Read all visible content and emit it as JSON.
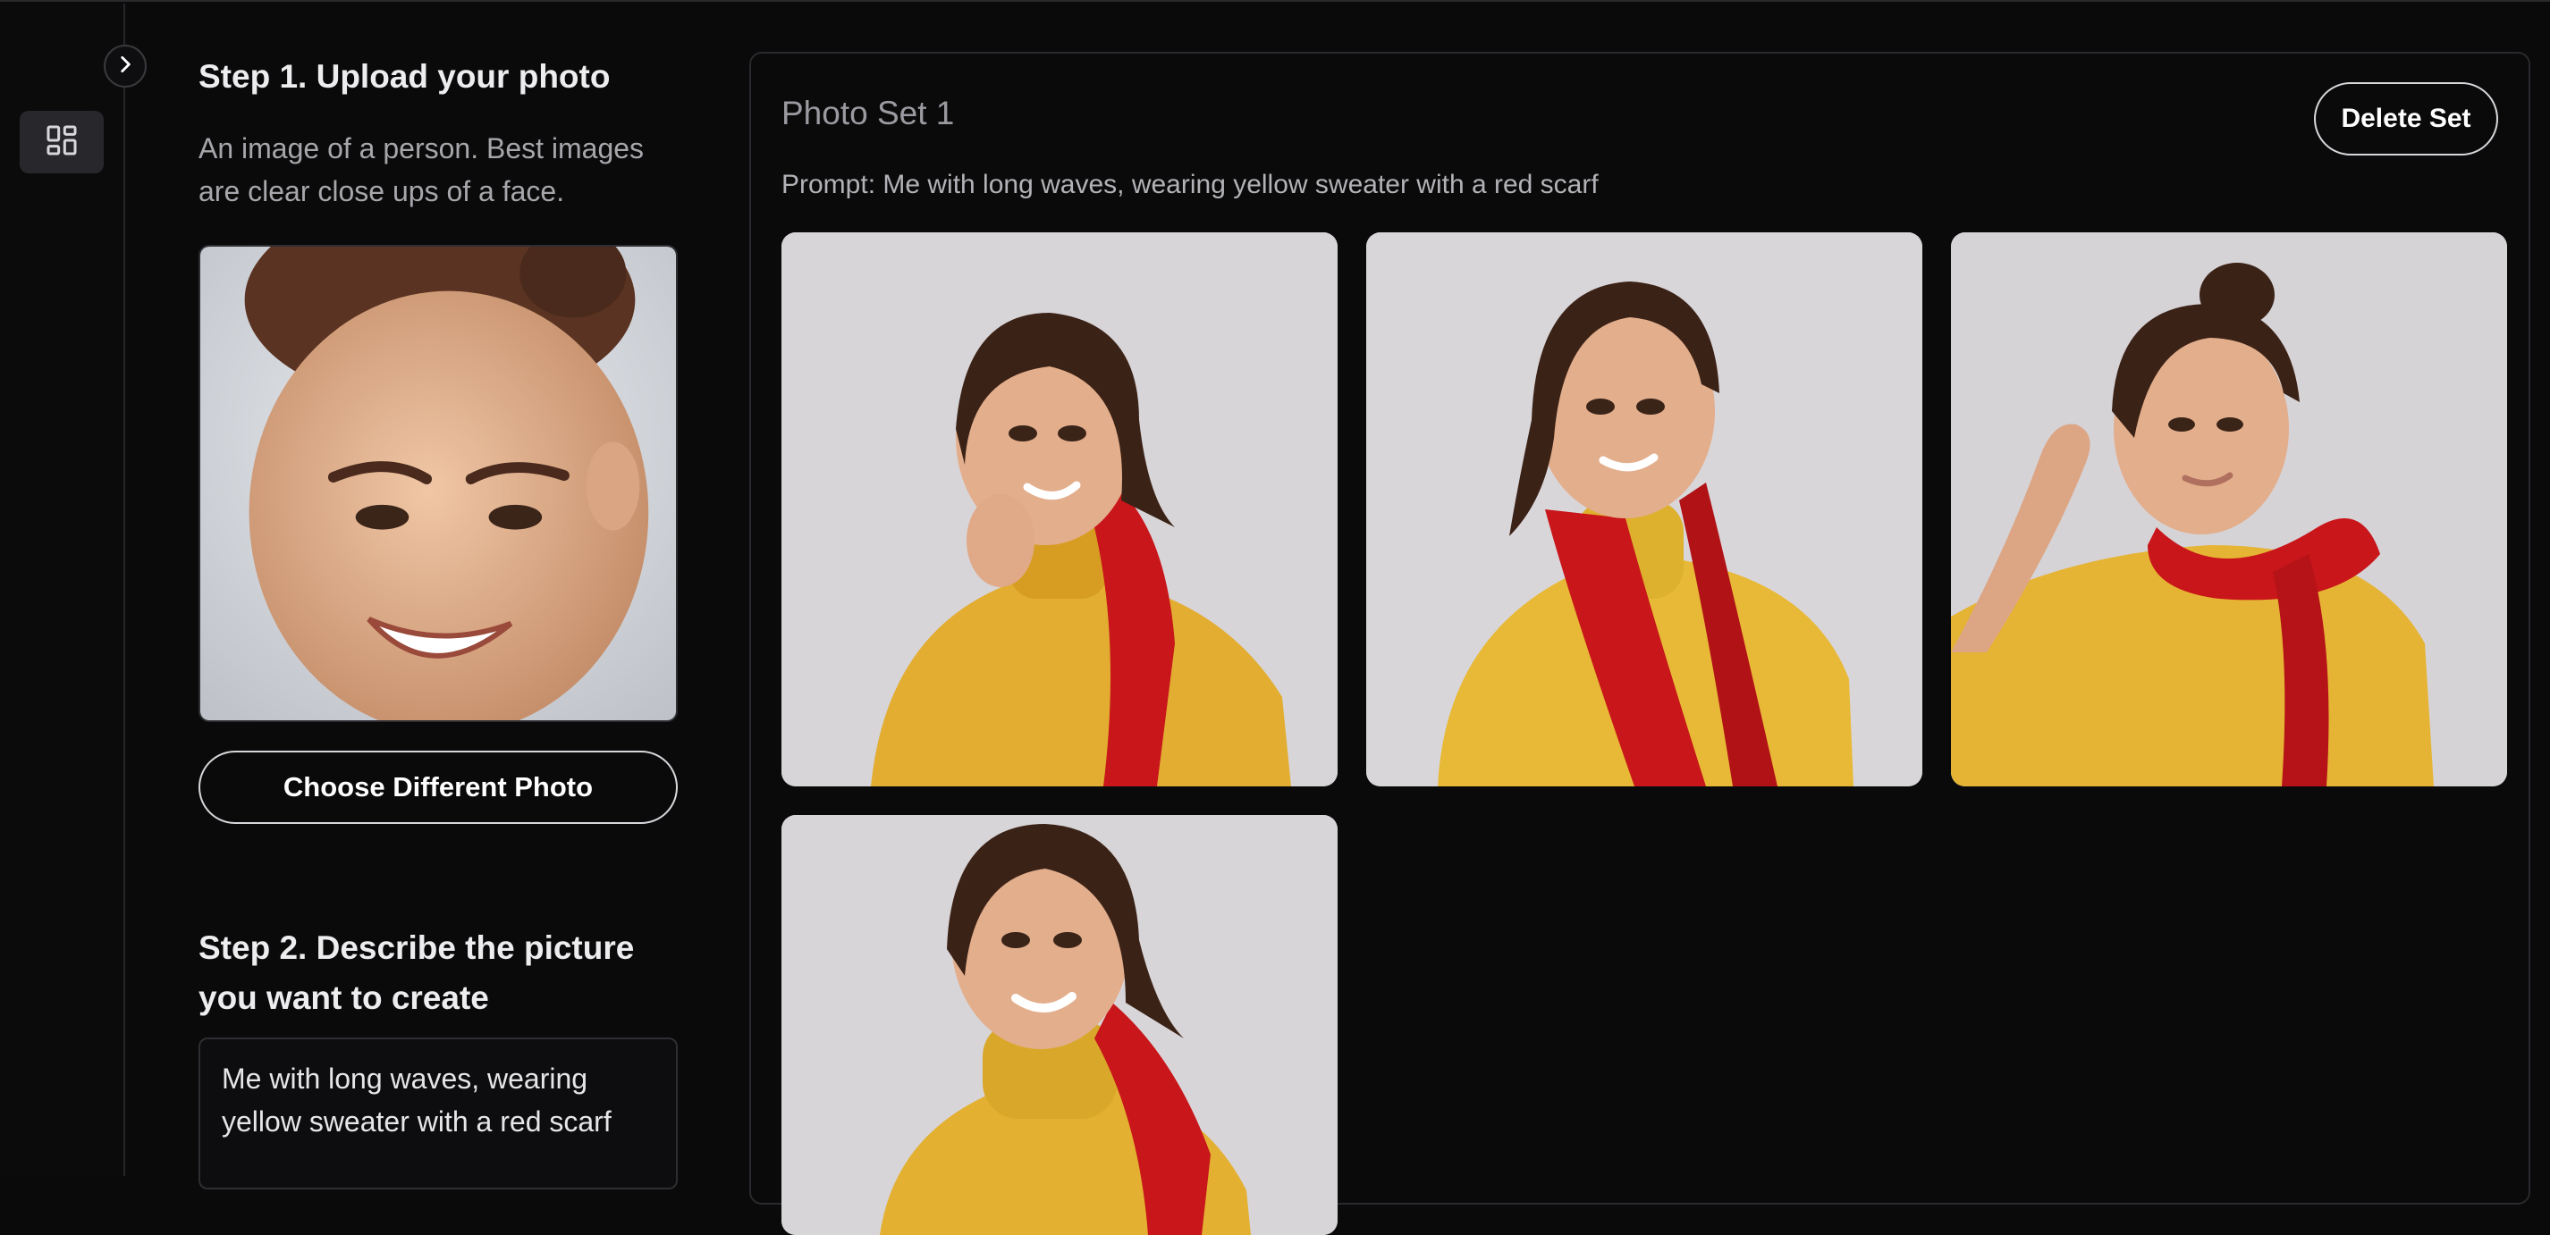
{
  "sidebar": {
    "collapse_icon": "chevron-right-icon",
    "grid_icon": "dashboard-grid-icon"
  },
  "step1": {
    "title": "Step 1. Upload your photo",
    "description": "An image of a person. Best images are clear close ups of a face.",
    "choose_button": "Choose Different Photo"
  },
  "step2": {
    "title": "Step 2. Describe the picture you want to create",
    "prompt_value": "Me with long waves, wearing yellow sweater with a red scarf"
  },
  "photo_set": {
    "title": "Photo Set 1",
    "delete_button": "Delete Set",
    "prompt_line": "Prompt: Me with long waves, wearing yellow sweater with a red scarf",
    "photo_count": 4
  },
  "colors": {
    "background": "#0a0a0b",
    "sweater": "#e6b232",
    "scarf": "#c41414",
    "photo_backdrop": "#d6d3d6"
  }
}
